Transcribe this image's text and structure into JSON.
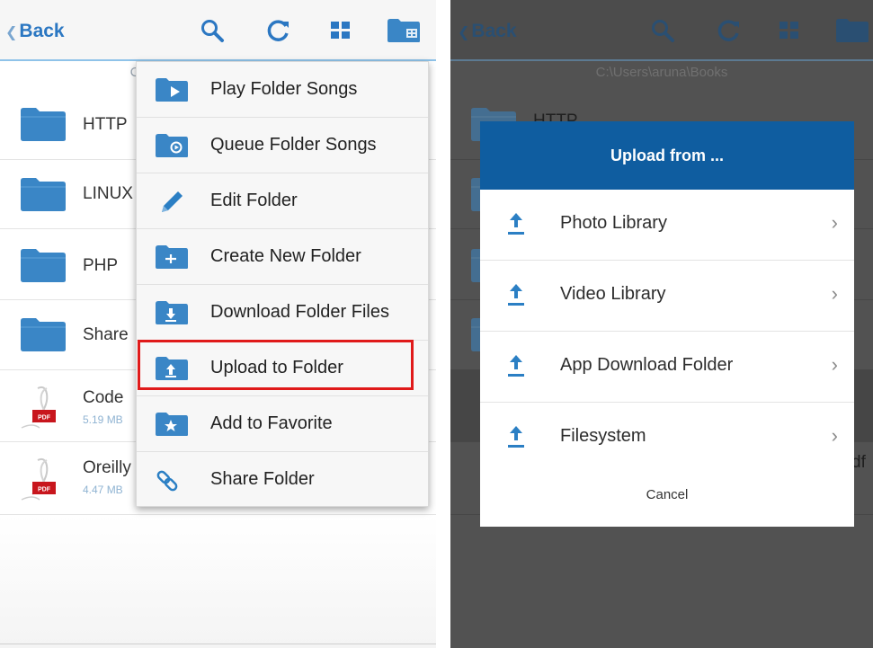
{
  "left_screen": {
    "back_label": "Back",
    "toolbar_icons": [
      "search-icon",
      "refresh-icon",
      "grid-view-icon",
      "folder-menu-icon"
    ],
    "path_fragment": "C",
    "files": [
      {
        "name": "HTTP",
        "type": "folder"
      },
      {
        "name": "LINUX",
        "type": "folder"
      },
      {
        "name": "PHP",
        "type": "folder"
      },
      {
        "name": "Share",
        "type": "folder"
      },
      {
        "name": "Code",
        "type": "pdf",
        "size": "5.19 MB"
      },
      {
        "name": "Oreilly",
        "type": "pdf",
        "size": "4.47 MB"
      }
    ],
    "menu": [
      {
        "label": "Play Folder Songs",
        "icon": "play-folder-icon"
      },
      {
        "label": "Queue Folder Songs",
        "icon": "queue-folder-icon"
      },
      {
        "label": "Edit Folder",
        "icon": "pencil-icon"
      },
      {
        "label": "Create New Folder",
        "icon": "new-folder-icon"
      },
      {
        "label": "Download Folder Files",
        "icon": "download-folder-icon"
      },
      {
        "label": "Upload to Folder",
        "icon": "upload-folder-icon",
        "highlighted": true
      },
      {
        "label": "Add to Favorite",
        "icon": "favorite-folder-icon"
      },
      {
        "label": "Share Folder",
        "icon": "link-icon"
      }
    ]
  },
  "right_screen": {
    "back_label": "Back",
    "path": "C:\\Users\\aruna\\Books",
    "background_rows": [
      "HTTP"
    ],
    "dialog": {
      "title": "Upload from ...",
      "options": [
        "Photo Library",
        "Video Library",
        "App Download Folder",
        "Filesystem"
      ],
      "cancel_label": "Cancel"
    },
    "partial_text": "df"
  },
  "colors": {
    "accent": "#2b77c2",
    "dialog_header": "#0f5da0",
    "folder": "#3a86c6",
    "highlight_border": "#e01a1a",
    "pdf_red": "#c8161d"
  }
}
